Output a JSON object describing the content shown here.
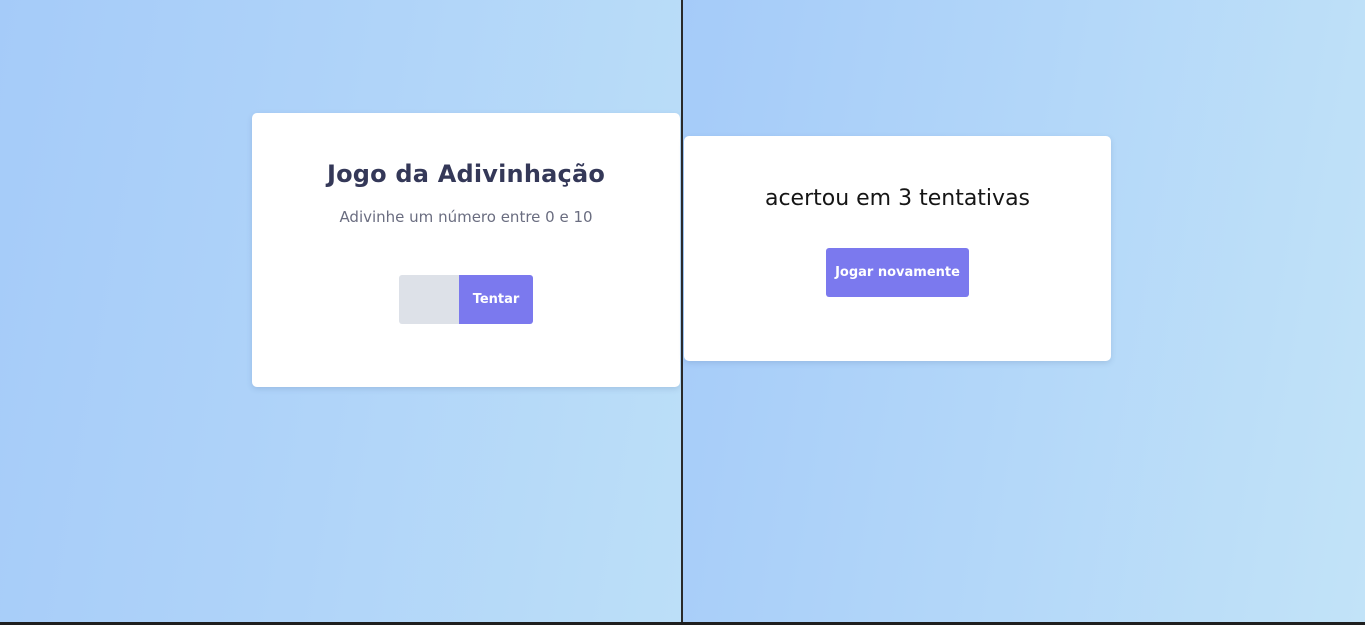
{
  "game": {
    "title": "Jogo da Adivinhação",
    "subtitle": "Adivinhe um número entre 0 e 10",
    "guess_value": "",
    "try_label": "Tentar"
  },
  "result": {
    "message": "acertou em 3 tentativas",
    "play_again_label": "Jogar novamente"
  },
  "colors": {
    "button": "#7b79ee",
    "title": "#343858",
    "input_bg": "#dde1e8",
    "card_bg": "#ffffff"
  }
}
